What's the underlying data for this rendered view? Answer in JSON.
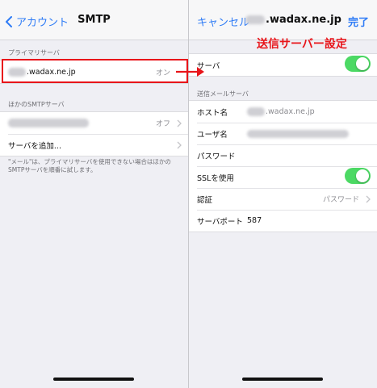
{
  "left": {
    "nav": {
      "back_label": "アカウント",
      "title": "SMTP"
    },
    "primary_header": "プライマリサーバ",
    "primary_server": {
      "name_suffix": ".wadax.ne.jp",
      "status": "オン"
    },
    "other_header": "ほかのSMTPサーバ",
    "other_server": {
      "status": "オフ"
    },
    "add_server_label": "サーバを追加...",
    "footer_note": "\"メール\"は、プライマリサーバを使用できない場合はほかのSMTPサーバを順番に試します。"
  },
  "right": {
    "nav": {
      "cancel_label": "キャンセル",
      "title_suffix": ".wadax.ne.jp",
      "done_label": "完了"
    },
    "server_label": "サーバ",
    "server_enabled": true,
    "outgoing_header": "送信メールサーバ",
    "host": {
      "label": "ホスト名",
      "value_suffix": ".wadax.ne.jp"
    },
    "username_label": "ユーザ名",
    "password_label": "パスワード",
    "ssl": {
      "label": "SSLを使用",
      "enabled": true
    },
    "auth": {
      "label": "認証",
      "value": "パスワード"
    },
    "port": {
      "label": "サーバポート",
      "value": "587"
    }
  },
  "annotation": {
    "text": "送信サーバー設定"
  },
  "colors": {
    "accent": "#2f7cf6",
    "toggle_on": "#4cd964",
    "annotation": "#e8151a"
  }
}
